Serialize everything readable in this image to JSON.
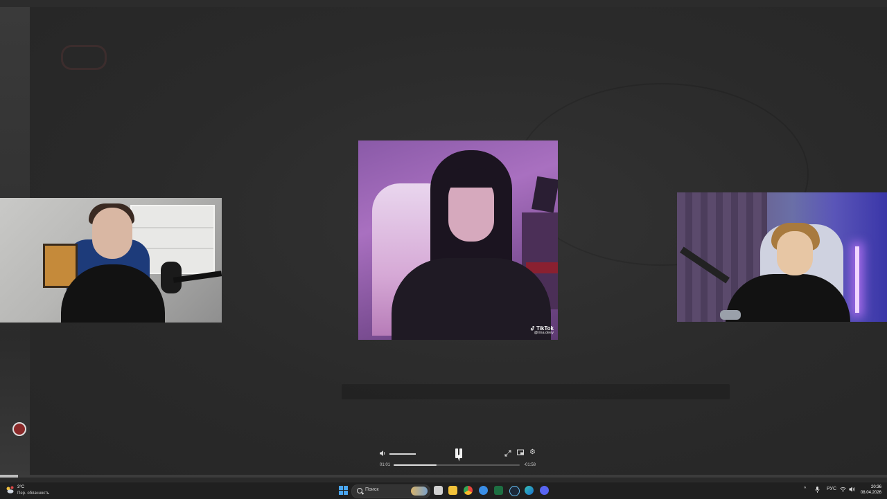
{
  "stream": {
    "center_video": {
      "tiktok_brand": "TikTok",
      "tiktok_handle": "@rina.deey"
    }
  },
  "player": {
    "elapsed": "01:01",
    "remaining": "-01:58",
    "progress_fraction": 0.34,
    "volume_fraction": 1.0,
    "state": "playing"
  },
  "page_seek": {
    "progress_fraction": 0.02
  },
  "taskbar": {
    "weather_temp": "3°C",
    "weather_condition": "Пер. облачность",
    "search_placeholder": "Поиск",
    "language": "РУС",
    "time": "20:36",
    "date": "08.04.2026",
    "apps": [
      "file-explorer-icon",
      "folder-icon",
      "chrome-icon",
      "browser-icon",
      "excel-icon",
      "steam-icon",
      "edge-icon",
      "discord-icon"
    ]
  },
  "colors": {
    "accent_blue": "#4aa6f0",
    "taskbar_bg": "#202020",
    "stage_bg": "#2a2a2a"
  }
}
